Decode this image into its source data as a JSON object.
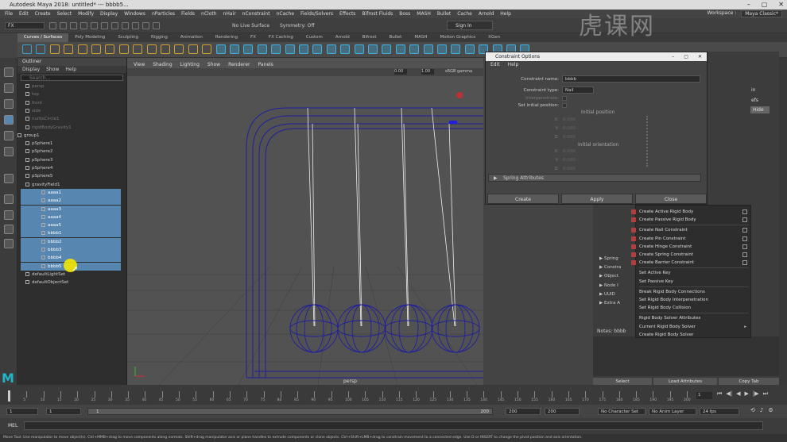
{
  "window_title": "Autodesk Maya 2018: untitled*   ---   bbbb5...",
  "menubar": {
    "items": [
      "File",
      "Edit",
      "Create",
      "Select",
      "Modify",
      "Display",
      "Windows",
      "nParticles",
      "Fields",
      "nCloth",
      "nHair",
      "nConstraint",
      "nCache",
      "Fields/Solvers",
      "Effects",
      "Bifrost Fluids",
      "Boss",
      "MASH",
      "Bullet",
      "Cache",
      "Arnold",
      "Help"
    ],
    "workspace_label": "Workspace :",
    "workspace_value": "Maya Classic*"
  },
  "statusline": {
    "mode": "FX",
    "live_surface": "No Live Surface",
    "symmetry": "Symmetry: Off",
    "sign_in": "Sign In"
  },
  "shelf_tabs": [
    "Curves / Surfaces",
    "Poly Modeling",
    "Sculpting",
    "Rigging",
    "Animation",
    "Rendering",
    "FX",
    "FX Caching",
    "Custom",
    "Arnold",
    "Bifrost",
    "Bullet",
    "MASH",
    "Motion Graphics",
    "XGen"
  ],
  "shelf_active": "Curves / Surfaces",
  "outliner": {
    "title": "Outliner",
    "menu": [
      "Display",
      "Show",
      "Help"
    ],
    "search_placeholder": "Search...",
    "items": [
      {
        "label": "persp",
        "state": "dim",
        "indent": 1
      },
      {
        "label": "top",
        "state": "dim",
        "indent": 1
      },
      {
        "label": "front",
        "state": "dim",
        "indent": 1
      },
      {
        "label": "side",
        "state": "dim",
        "indent": 1
      },
      {
        "label": "nurbsCircle1",
        "state": "dim",
        "indent": 1
      },
      {
        "label": "rigidBodyGravity1",
        "state": "dim",
        "indent": 1
      },
      {
        "label": "group1",
        "state": "normal",
        "indent": 0
      },
      {
        "label": "pSphere1",
        "state": "normal",
        "indent": 1
      },
      {
        "label": "pSphere2",
        "state": "normal",
        "indent": 1
      },
      {
        "label": "pSphere3",
        "state": "normal",
        "indent": 1
      },
      {
        "label": "pSphere4",
        "state": "normal",
        "indent": 1
      },
      {
        "label": "pSphere5",
        "state": "normal",
        "indent": 1
      },
      {
        "label": "gravityField1",
        "state": "normal",
        "indent": 1
      },
      {
        "label": "aaaa1",
        "state": "sel",
        "indent": 1
      },
      {
        "label": "aaaa2",
        "state": "sel",
        "indent": 1
      },
      {
        "label": "aaaa3",
        "state": "sel",
        "indent": 1
      },
      {
        "label": "aaaa4",
        "state": "sel",
        "indent": 1
      },
      {
        "label": "aaaa5",
        "state": "sel",
        "indent": 1
      },
      {
        "label": "bbbb1",
        "state": "sel",
        "indent": 1
      },
      {
        "label": "bbbb2",
        "state": "sel",
        "indent": 1
      },
      {
        "label": "bbbb3",
        "state": "sel",
        "indent": 1
      },
      {
        "label": "bbbb4",
        "state": "sel",
        "indent": 1
      },
      {
        "label": "bbbb5",
        "state": "sel",
        "indent": 1
      },
      {
        "label": "defaultLightSet",
        "state": "normal",
        "indent": 1
      },
      {
        "label": "defaultObjectSet",
        "state": "normal",
        "indent": 1
      }
    ]
  },
  "viewport": {
    "menu": [
      "View",
      "Shading",
      "Lighting",
      "Show",
      "Renderer",
      "Panels"
    ],
    "camera_label": "persp",
    "exposure": "0.00",
    "gamma": "1.00",
    "color_space": "sRGB gamma"
  },
  "dialog": {
    "title": "Constraint Options",
    "menu": [
      "Edit",
      "Help"
    ],
    "constraint_name_label": "Constraint name:",
    "constraint_name_value": "bbbb",
    "constraint_type_label": "Constraint type:",
    "constraint_type_value": "Nail",
    "interpenetrate_label": "Interpenetrate:",
    "set_initial_position_label": "Set initial position:",
    "initial_position_heading": "Initial position",
    "initial_orientation_heading": "Initial orientation",
    "x_label": "X:",
    "y_label": "Y:",
    "z_label": "Z:",
    "pos_values": [
      "0.000",
      "0.000",
      "0.000"
    ],
    "ori_values": [
      "0.000",
      "0.000",
      "0.000"
    ],
    "spring_attributes": "Spring Attributes",
    "buttons": [
      "Create",
      "Apply",
      "Close"
    ]
  },
  "right_panel": {
    "rows": [
      "Spring",
      "Constra",
      "Object",
      "Node I",
      "UUID",
      "Extra A"
    ],
    "notes_label": "Notes: bbbb",
    "buttons": [
      "Select",
      "Load Attributes",
      "Copy Tab"
    ],
    "partial_buttons": [
      "in",
      "efs",
      "Hide"
    ]
  },
  "context_menu": {
    "items": [
      {
        "label": "Create Active Rigid Body",
        "box": true,
        "icon": true
      },
      {
        "label": "Create Passive Rigid Body",
        "box": true,
        "icon": true
      },
      {
        "divider": true
      },
      {
        "label": "Create Nail Constraint",
        "box": true,
        "icon": true
      },
      {
        "label": "Create Pin Constraint",
        "box": true,
        "icon": true
      },
      {
        "label": "Create Hinge Constraint",
        "box": true,
        "icon": true
      },
      {
        "label": "Create Spring Constraint",
        "box": true,
        "icon": true
      },
      {
        "label": "Create Barrier Constraint",
        "box": true,
        "icon": true
      },
      {
        "divider": true
      },
      {
        "label": "Set Active Key",
        "box": false
      },
      {
        "label": "Set Passive Key",
        "box": false
      },
      {
        "divider": true
      },
      {
        "label": "Break Rigid Body Connections",
        "box": false
      },
      {
        "label": "Set Rigid Body Interpenetration",
        "box": false
      },
      {
        "label": "Set Rigid Body Collision",
        "box": false
      },
      {
        "divider": true
      },
      {
        "label": "Rigid Body Solver Attributes",
        "box": false
      },
      {
        "label": "Current Rigid Body Solver",
        "box": false,
        "arrow": true
      },
      {
        "label": "Create Rigid Body Solver",
        "box": false
      }
    ]
  },
  "timeline": {
    "ticks": [
      "5",
      "10",
      "15",
      "20",
      "25",
      "30",
      "35",
      "40",
      "45",
      "50",
      "55",
      "60",
      "65",
      "70",
      "75",
      "80",
      "85",
      "90",
      "95",
      "100",
      "105",
      "110",
      "115",
      "120",
      "125",
      "130",
      "135",
      "140",
      "145",
      "150",
      "155",
      "160",
      "165",
      "170",
      "175",
      "180",
      "185",
      "190",
      "195",
      "200"
    ],
    "current_frame": "1"
  },
  "range": {
    "start": "1",
    "start2": "1",
    "slider_start": "1",
    "slider_end": "200",
    "end": "200",
    "end2": "200",
    "character_set": "No Character Set",
    "anim_layer": "No Anim Layer",
    "fps": "24 fps"
  },
  "cmdline": {
    "label": "MEL"
  },
  "helpline": "Move Tool: Use manipulator to move object(s). Ctrl+MMB+drag to move components along normals. Shift+drag manipulator axis or plane handles to extrude components or clone objects. Ctrl+Shift+LMB+drag to constrain movement to a connected edge. Use D or INSERT to change the pivot position and axis orientation.",
  "logo": "M",
  "watermark": "虎课网",
  "colors": {
    "selection": "#5786b0",
    "wire": "#1f1f9e",
    "cursor_highlight": "#f5e600"
  }
}
